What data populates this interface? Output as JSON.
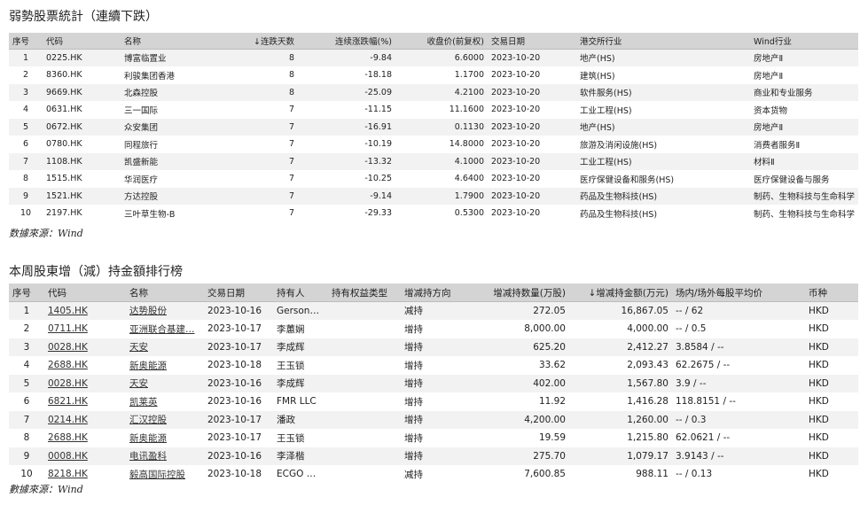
{
  "table1": {
    "title": "弱勢股票統計（連續下跌）",
    "headers": [
      "序号",
      "代码",
      "名称",
      "↓连跌天数",
      "连续涨跌幅(%)",
      "收盘价(前复权)",
      "交易日期",
      "港交所行业",
      "Wind行业"
    ],
    "rows": [
      [
        "1",
        "0225.HK",
        "博富临置业",
        "8",
        "-9.84",
        "6.6000",
        "2023-10-20",
        "地产(HS)",
        "房地产Ⅱ"
      ],
      [
        "2",
        "8360.HK",
        "利骏集团香港",
        "8",
        "-18.18",
        "1.1700",
        "2023-10-20",
        "建筑(HS)",
        "房地产Ⅱ"
      ],
      [
        "3",
        "9669.HK",
        "北森控股",
        "8",
        "-25.09",
        "4.2100",
        "2023-10-20",
        "软件服务(HS)",
        "商业和专业服务"
      ],
      [
        "4",
        "0631.HK",
        "三一国际",
        "7",
        "-11.15",
        "11.1600",
        "2023-10-20",
        "工业工程(HS)",
        "资本货物"
      ],
      [
        "5",
        "0672.HK",
        "众安集团",
        "7",
        "-16.91",
        "0.1130",
        "2023-10-20",
        "地产(HS)",
        "房地产Ⅱ"
      ],
      [
        "6",
        "0780.HK",
        "同程旅行",
        "7",
        "-10.19",
        "14.8000",
        "2023-10-20",
        "旅游及消闲设施(HS)",
        "消费者服务Ⅱ"
      ],
      [
        "7",
        "1108.HK",
        "凯盛新能",
        "7",
        "-13.32",
        "4.1000",
        "2023-10-20",
        "工业工程(HS)",
        "材料Ⅱ"
      ],
      [
        "8",
        "1515.HK",
        "华润医疗",
        "7",
        "-10.25",
        "4.6400",
        "2023-10-20",
        "医疗保健设备和服务(HS)",
        "医疗保健设备与服务"
      ],
      [
        "9",
        "1521.HK",
        "方达控股",
        "7",
        "-9.14",
        "1.7900",
        "2023-10-20",
        "药品及生物科技(HS)",
        "制药、生物科技与生命科学"
      ],
      [
        "10",
        "2197.HK",
        "三叶草生物-B",
        "7",
        "-29.33",
        "0.5300",
        "2023-10-20",
        "药品及生物科技(HS)",
        "制药、生物科技与生命科学"
      ]
    ],
    "source": "数據來源：Wind"
  },
  "table2": {
    "title": "本周股東增（減）持金額排行榜",
    "headers": [
      "序号",
      "代码",
      "名称",
      "交易日期",
      "持有人",
      "持有权益类型",
      "增减持方向",
      "增减持数量(万股)",
      "↓增减持金额(万元)",
      "场内/场外每股平均价",
      "币种"
    ],
    "rows": [
      [
        "1",
        "1405.HK",
        "达势股份",
        "2023-10-16",
        "Gerson…",
        "",
        "减持",
        "272.05",
        "16,867.05",
        "-- / 62",
        "HKD"
      ],
      [
        "2",
        "0711.HK",
        "亚洲联合基建…",
        "2023-10-17",
        "李蕙娴",
        "",
        "增持",
        "8,000.00",
        "4,000.00",
        "-- / 0.5",
        "HKD"
      ],
      [
        "3",
        "0028.HK",
        "天安",
        "2023-10-17",
        "李成辉",
        "",
        "增持",
        "625.20",
        "2,412.27",
        "3.8584 / --",
        "HKD"
      ],
      [
        "4",
        "2688.HK",
        "新奥能源",
        "2023-10-18",
        "王玉锁",
        "",
        "增持",
        "33.62",
        "2,093.43",
        "62.2675 / --",
        "HKD"
      ],
      [
        "5",
        "0028.HK",
        "天安",
        "2023-10-16",
        "李成辉",
        "",
        "增持",
        "402.00",
        "1,567.80",
        "3.9 / --",
        "HKD"
      ],
      [
        "6",
        "6821.HK",
        "凯莱英",
        "2023-10-16",
        "FMR LLC",
        "",
        "增持",
        "11.92",
        "1,416.28",
        "118.8151 / --",
        "HKD"
      ],
      [
        "7",
        "0214.HK",
        "汇汉控股",
        "2023-10-17",
        "潘政",
        "",
        "增持",
        "4,200.00",
        "1,260.00",
        "-- / 0.3",
        "HKD"
      ],
      [
        "8",
        "2688.HK",
        "新奥能源",
        "2023-10-17",
        "王玉锁",
        "",
        "增持",
        "19.59",
        "1,215.80",
        "62.0621 / --",
        "HKD"
      ],
      [
        "9",
        "0008.HK",
        "电讯盈科",
        "2023-10-16",
        "李泽楷",
        "",
        "增持",
        "275.70",
        "1,079.17",
        "3.9143 / --",
        "HKD"
      ],
      [
        "10",
        "8218.HK",
        "毅高国际控股",
        "2023-10-18",
        "ECGO …",
        "",
        "减持",
        "7,600.85",
        "988.11",
        "-- / 0.13",
        "HKD"
      ]
    ],
    "source": "數據來源：Wind"
  }
}
